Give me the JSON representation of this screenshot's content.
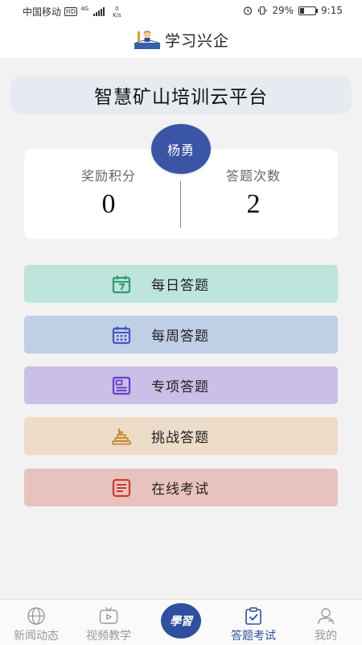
{
  "status_bar": {
    "carrier": "中国移动",
    "hd": "HD",
    "network_type": "4G",
    "net_speed_value": "0",
    "net_speed_unit": "K/s",
    "battery_percent": "29%",
    "battery_level": 0.29,
    "time": "9:15"
  },
  "header": {
    "title": "学习兴企",
    "logo_icon": "reading-student-logo"
  },
  "banner": {
    "title": "智慧矿山培训云平台"
  },
  "user": {
    "name": "杨勇"
  },
  "stats": {
    "points_label": "奖励积分",
    "points_value": "0",
    "answers_label": "答题次数",
    "answers_value": "2"
  },
  "menu": [
    {
      "label": "每日答题",
      "icon": "calendar-day-icon",
      "bg": "#bde5db",
      "icon_color": "#2f9a76"
    },
    {
      "label": "每周答题",
      "icon": "calendar-week-icon",
      "bg": "#bfcfe6",
      "icon_color": "#4656c8"
    },
    {
      "label": "专项答题",
      "icon": "special-topic-icon",
      "bg": "#c9bfe7",
      "icon_color": "#6a3fc8"
    },
    {
      "label": "挑战答题",
      "icon": "challenge-stairs-icon",
      "bg": "#ecdcc8",
      "icon_color": "#c8862c"
    },
    {
      "label": "在线考试",
      "icon": "online-exam-icon",
      "bg": "#e8c3bd",
      "icon_color": "#cc3a32"
    }
  ],
  "bottom_nav": {
    "items": [
      {
        "label": "新闻动态",
        "icon": "globe-icon"
      },
      {
        "label": "视频教学",
        "icon": "tv-icon"
      },
      {
        "label": "答题考试",
        "icon": "clipboard-check-icon"
      },
      {
        "label": "我的",
        "icon": "user-icon"
      }
    ],
    "center_logo_text": "學習",
    "active_color": "#2f4fa0"
  }
}
